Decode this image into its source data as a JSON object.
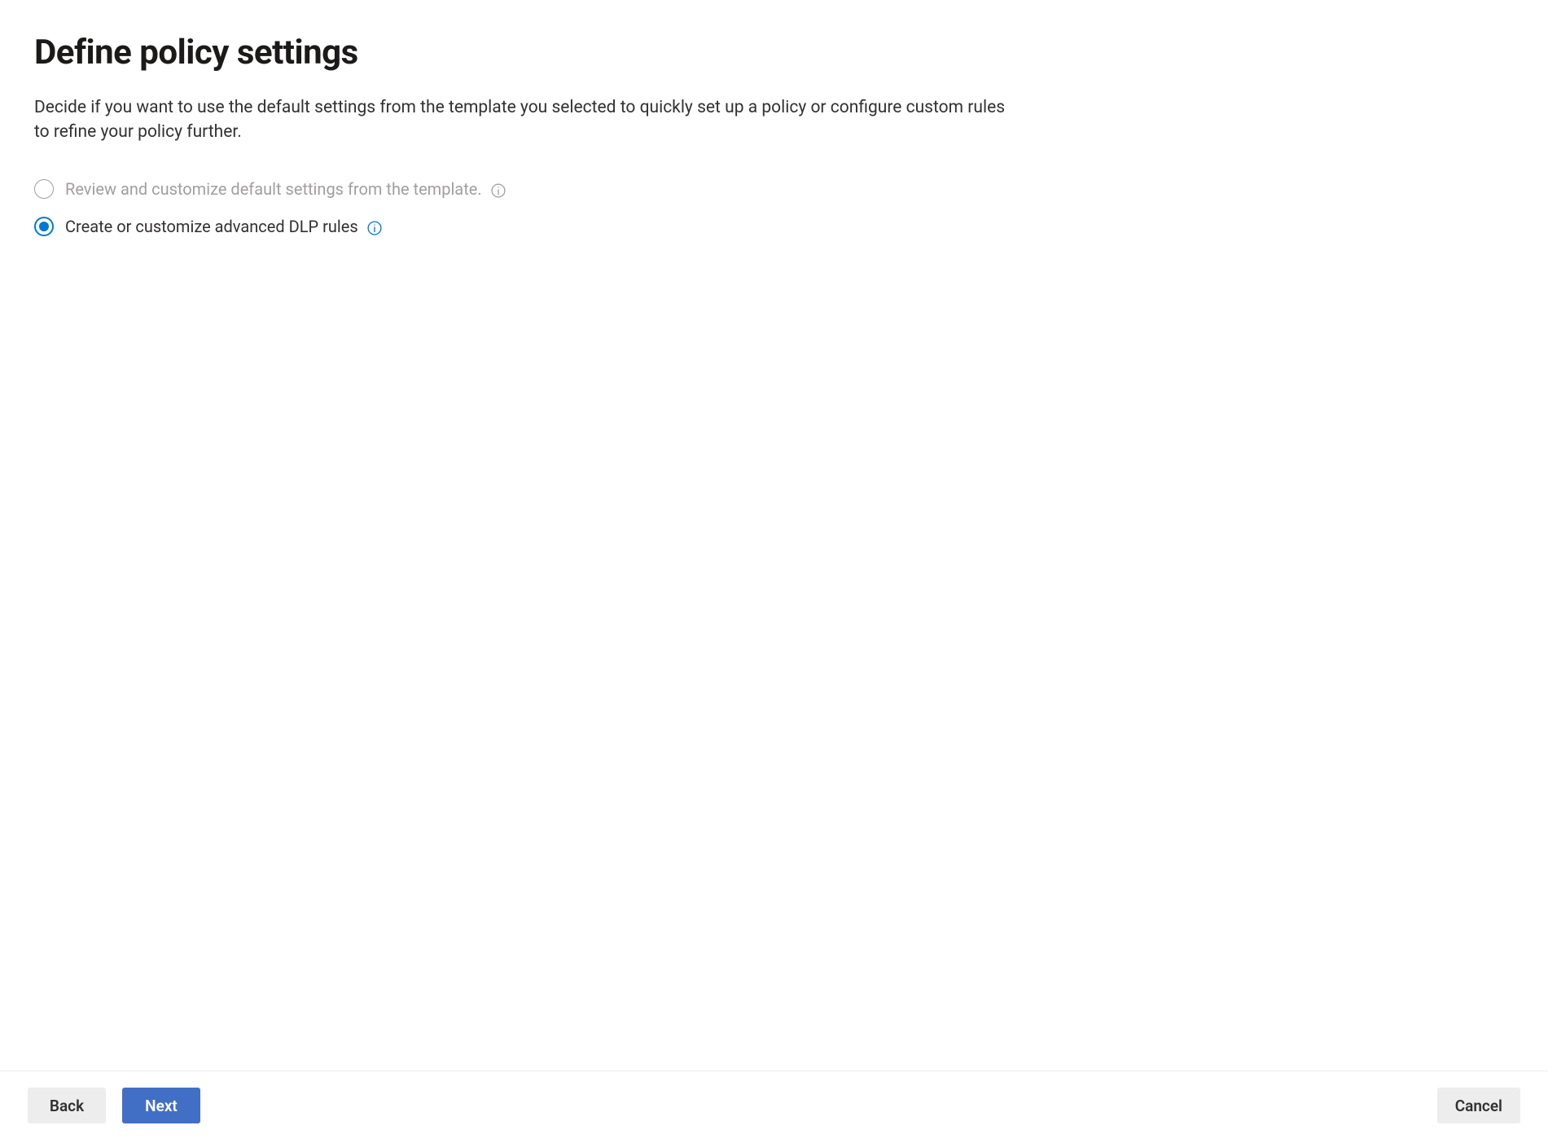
{
  "header": {
    "title": "Define policy settings",
    "description": "Decide if you want to use the default settings from the template you selected to quickly set up a policy or configure custom rules to refine your policy further."
  },
  "options": {
    "default_template": {
      "label": "Review and customize default settings from the template.",
      "selected": false,
      "disabled": true
    },
    "advanced_rules": {
      "label": "Create or customize advanced DLP rules",
      "selected": true,
      "disabled": false
    }
  },
  "footer": {
    "back_label": "Back",
    "next_label": "Next",
    "cancel_label": "Cancel"
  },
  "colors": {
    "primary": "#0078d4",
    "button_primary": "#426fc6",
    "text": "#323130",
    "text_disabled": "#a19f9d",
    "border_light": "#edebe9",
    "button_secondary_bg": "#ededed"
  }
}
